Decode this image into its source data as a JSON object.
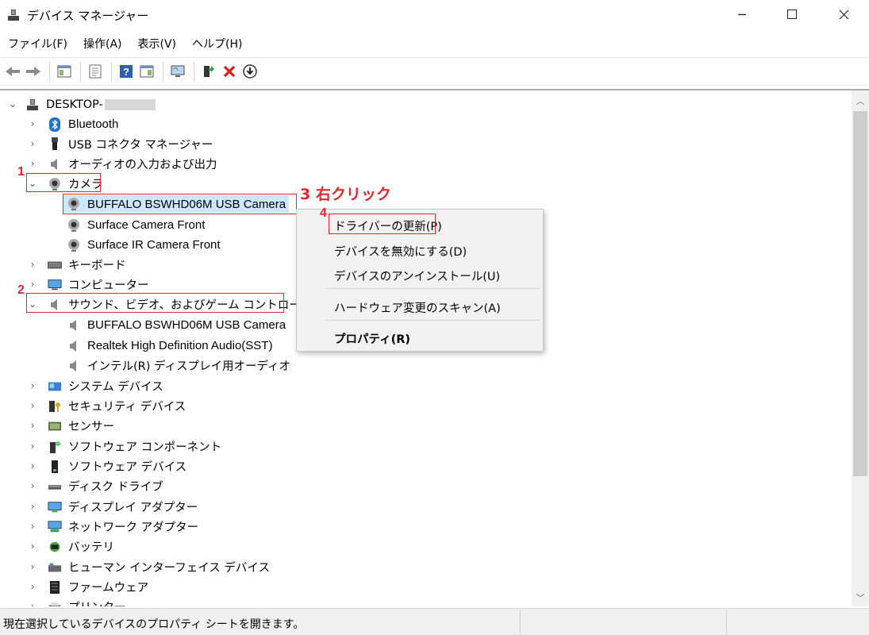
{
  "window": {
    "title": "デバイス マネージャー"
  },
  "menubar": [
    "ファイル(F)",
    "操作(A)",
    "表示(V)",
    "ヘルプ(H)"
  ],
  "tree": {
    "root": "DESKTOP-",
    "items": [
      {
        "label": "Bluetooth",
        "icon": "bluetooth-icon"
      },
      {
        "label": "USB コネクタ マネージャー",
        "icon": "usb-connector-icon"
      },
      {
        "label": "オーディオの入力および出力",
        "icon": "speaker-icon"
      },
      {
        "label": "カメラ",
        "icon": "camera-icon"
      },
      {
        "label": "BUFFALO BSWHD06M USB Camera",
        "icon": "camera-icon"
      },
      {
        "label": "Surface Camera Front",
        "icon": "camera-icon"
      },
      {
        "label": "Surface IR Camera Front",
        "icon": "camera-icon"
      },
      {
        "label": "キーボード",
        "icon": "keyboard-icon"
      },
      {
        "label": "コンピューター",
        "icon": "computer-icon"
      },
      {
        "label": "サウンド、ビデオ、およびゲーム コントローラー",
        "icon": "speaker-icon"
      },
      {
        "label": "BUFFALO BSWHD06M USB Camera",
        "icon": "speaker-icon"
      },
      {
        "label": "Realtek High Definition Audio(SST)",
        "icon": "speaker-icon"
      },
      {
        "label": "インテル(R) ディスプレイ用オーディオ",
        "icon": "speaker-icon"
      },
      {
        "label": "システム デバイス",
        "icon": "system-device-icon"
      },
      {
        "label": "セキュリティ デバイス",
        "icon": "security-device-icon"
      },
      {
        "label": "センサー",
        "icon": "sensor-icon"
      },
      {
        "label": "ソフトウェア コンポーネント",
        "icon": "software-component-icon"
      },
      {
        "label": "ソフトウェア デバイス",
        "icon": "software-device-icon"
      },
      {
        "label": "ディスク ドライブ",
        "icon": "disk-drive-icon"
      },
      {
        "label": "ディスプレイ アダプター",
        "icon": "display-adapter-icon"
      },
      {
        "label": "ネットワーク アダプター",
        "icon": "network-adapter-icon"
      },
      {
        "label": "バッテリ",
        "icon": "battery-icon"
      },
      {
        "label": "ヒューマン インターフェイス デバイス",
        "icon": "hid-icon"
      },
      {
        "label": "ファームウェア",
        "icon": "firmware-icon"
      },
      {
        "label": "プリンター",
        "icon": "printer-icon"
      }
    ]
  },
  "context_menu": {
    "items": [
      "ドライバーの更新(P)",
      "デバイスを無効にする(D)",
      "デバイスのアンインストール(U)",
      "ハードウェア変更のスキャン(A)",
      "プロパティ(R)"
    ]
  },
  "annotations": {
    "step1": "1",
    "step2": "2",
    "step3": "3",
    "step3_label": "右クリック",
    "step4": "4"
  },
  "status": {
    "text": "現在選択しているデバイスのプロパティ シートを開きます。"
  },
  "colors": {
    "annotation": "#e0282e",
    "selection": "#cce8ff"
  }
}
